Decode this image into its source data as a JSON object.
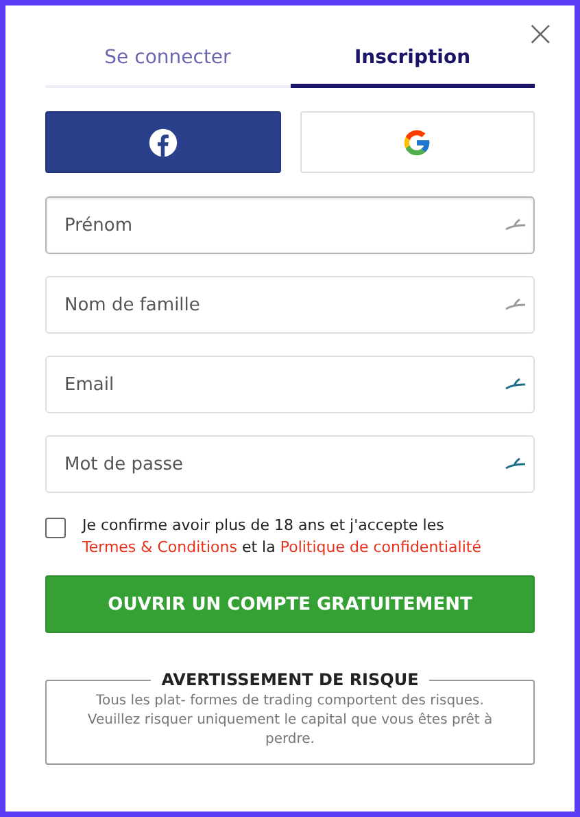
{
  "close": "×",
  "tabs": [
    {
      "label": "Se connecter",
      "selected": false
    },
    {
      "label": "Inscription",
      "selected": true
    }
  ],
  "social": [
    {
      "kind": "facebook"
    },
    {
      "kind": "google"
    }
  ],
  "fields": [
    {
      "placeholder": "Prénom",
      "focused": true,
      "color": "#9a9a9a"
    },
    {
      "placeholder": "Nom de famille",
      "focused": false,
      "color": "#9a9a9a"
    },
    {
      "placeholder": "Email",
      "focused": false,
      "color": "#1f6f8b"
    },
    {
      "placeholder": "Mot de passe",
      "focused": false,
      "color": "#1f6f8b"
    }
  ],
  "consent": {
    "checked": false,
    "parts": [
      {
        "kind": "text",
        "text": "Je confirme avoir plus de 18 ans et j'accepte les "
      },
      {
        "kind": "link",
        "text": "Termes & Conditions"
      },
      {
        "kind": "text",
        "text": " et la "
      },
      {
        "kind": "link",
        "text": "Politique de confidentialité"
      }
    ]
  },
  "submit": "OUVRIR UN COMPTE GRATUITEMENT",
  "risk": {
    "title": "AVERTISSEMENT DE RISQUE",
    "text": "Tous les plat- formes de trading comportent des risques. Veuillez risquer uniquement le capital que vous êtes prêt à perdre."
  }
}
